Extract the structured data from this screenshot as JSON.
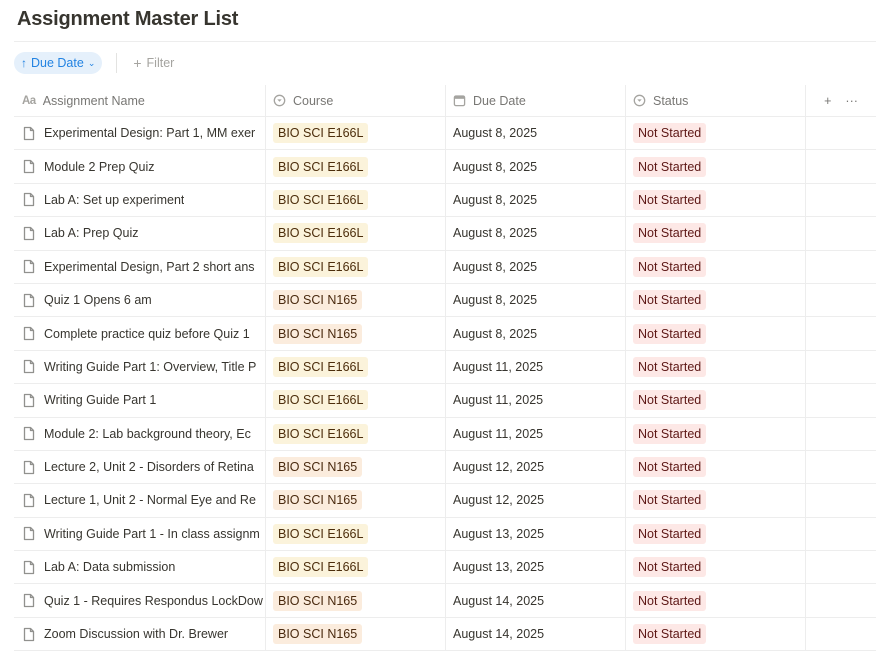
{
  "page": {
    "title": "Assignment Master List"
  },
  "toolbar": {
    "sort_label": "Due Date",
    "filter_label": "Filter"
  },
  "columns": {
    "name": "Assignment Name",
    "course": "Course",
    "due": "Due Date",
    "status": "Status"
  },
  "colors": {
    "accent": "#2383e2",
    "course_tag_bg": "#fbf3db",
    "course_tag_n_bg": "#fbecdd",
    "status_tag_bg": "#fde8e6"
  },
  "rows": [
    {
      "name": "Experimental Design: Part 1, MM exer",
      "course": "BIO SCI E166L",
      "due": "August 8, 2025",
      "status": "Not Started"
    },
    {
      "name": "Module 2 Prep Quiz",
      "course": "BIO SCI E166L",
      "due": "August 8, 2025",
      "status": "Not Started"
    },
    {
      "name": "Lab A: Set up experiment",
      "course": "BIO SCI E166L",
      "due": "August 8, 2025",
      "status": "Not Started"
    },
    {
      "name": "Lab A: Prep Quiz",
      "course": "BIO SCI E166L",
      "due": "August 8, 2025",
      "status": "Not Started"
    },
    {
      "name": "Experimental Design, Part 2 short ans",
      "course": "BIO SCI E166L",
      "due": "August 8, 2025",
      "status": "Not Started"
    },
    {
      "name": "Quiz 1 Opens 6 am",
      "course": "BIO SCI N165",
      "due": "August 8, 2025",
      "status": "Not Started"
    },
    {
      "name": "Complete practice quiz before Quiz 1",
      "course": "BIO SCI N165",
      "due": "August 8, 2025",
      "status": "Not Started"
    },
    {
      "name": "Writing Guide Part 1: Overview, Title P",
      "course": "BIO SCI E166L",
      "due": "August 11, 2025",
      "status": "Not Started"
    },
    {
      "name": "Writing Guide Part 1",
      "course": "BIO SCI E166L",
      "due": "August 11, 2025",
      "status": "Not Started"
    },
    {
      "name": "Module 2: Lab background theory, Ec",
      "course": "BIO SCI E166L",
      "due": "August 11, 2025",
      "status": "Not Started"
    },
    {
      "name": "Lecture 2, Unit 2 - Disorders of Retina",
      "course": "BIO SCI N165",
      "due": "August 12, 2025",
      "status": "Not Started"
    },
    {
      "name": "Lecture 1, Unit 2 - Normal Eye and Re",
      "course": "BIO SCI N165",
      "due": "August 12, 2025",
      "status": "Not Started"
    },
    {
      "name": "Writing Guide Part 1 - In class assignm",
      "course": "BIO SCI E166L",
      "due": "August 13, 2025",
      "status": "Not Started"
    },
    {
      "name": "Lab A: Data submission",
      "course": "BIO SCI E166L",
      "due": "August 13, 2025",
      "status": "Not Started"
    },
    {
      "name": "Quiz 1 - Requires Respondus LockDow",
      "course": "BIO SCI N165",
      "due": "August 14, 2025",
      "status": "Not Started"
    },
    {
      "name": "Zoom Discussion with Dr. Brewer",
      "course": "BIO SCI N165",
      "due": "August 14, 2025",
      "status": "Not Started"
    }
  ]
}
